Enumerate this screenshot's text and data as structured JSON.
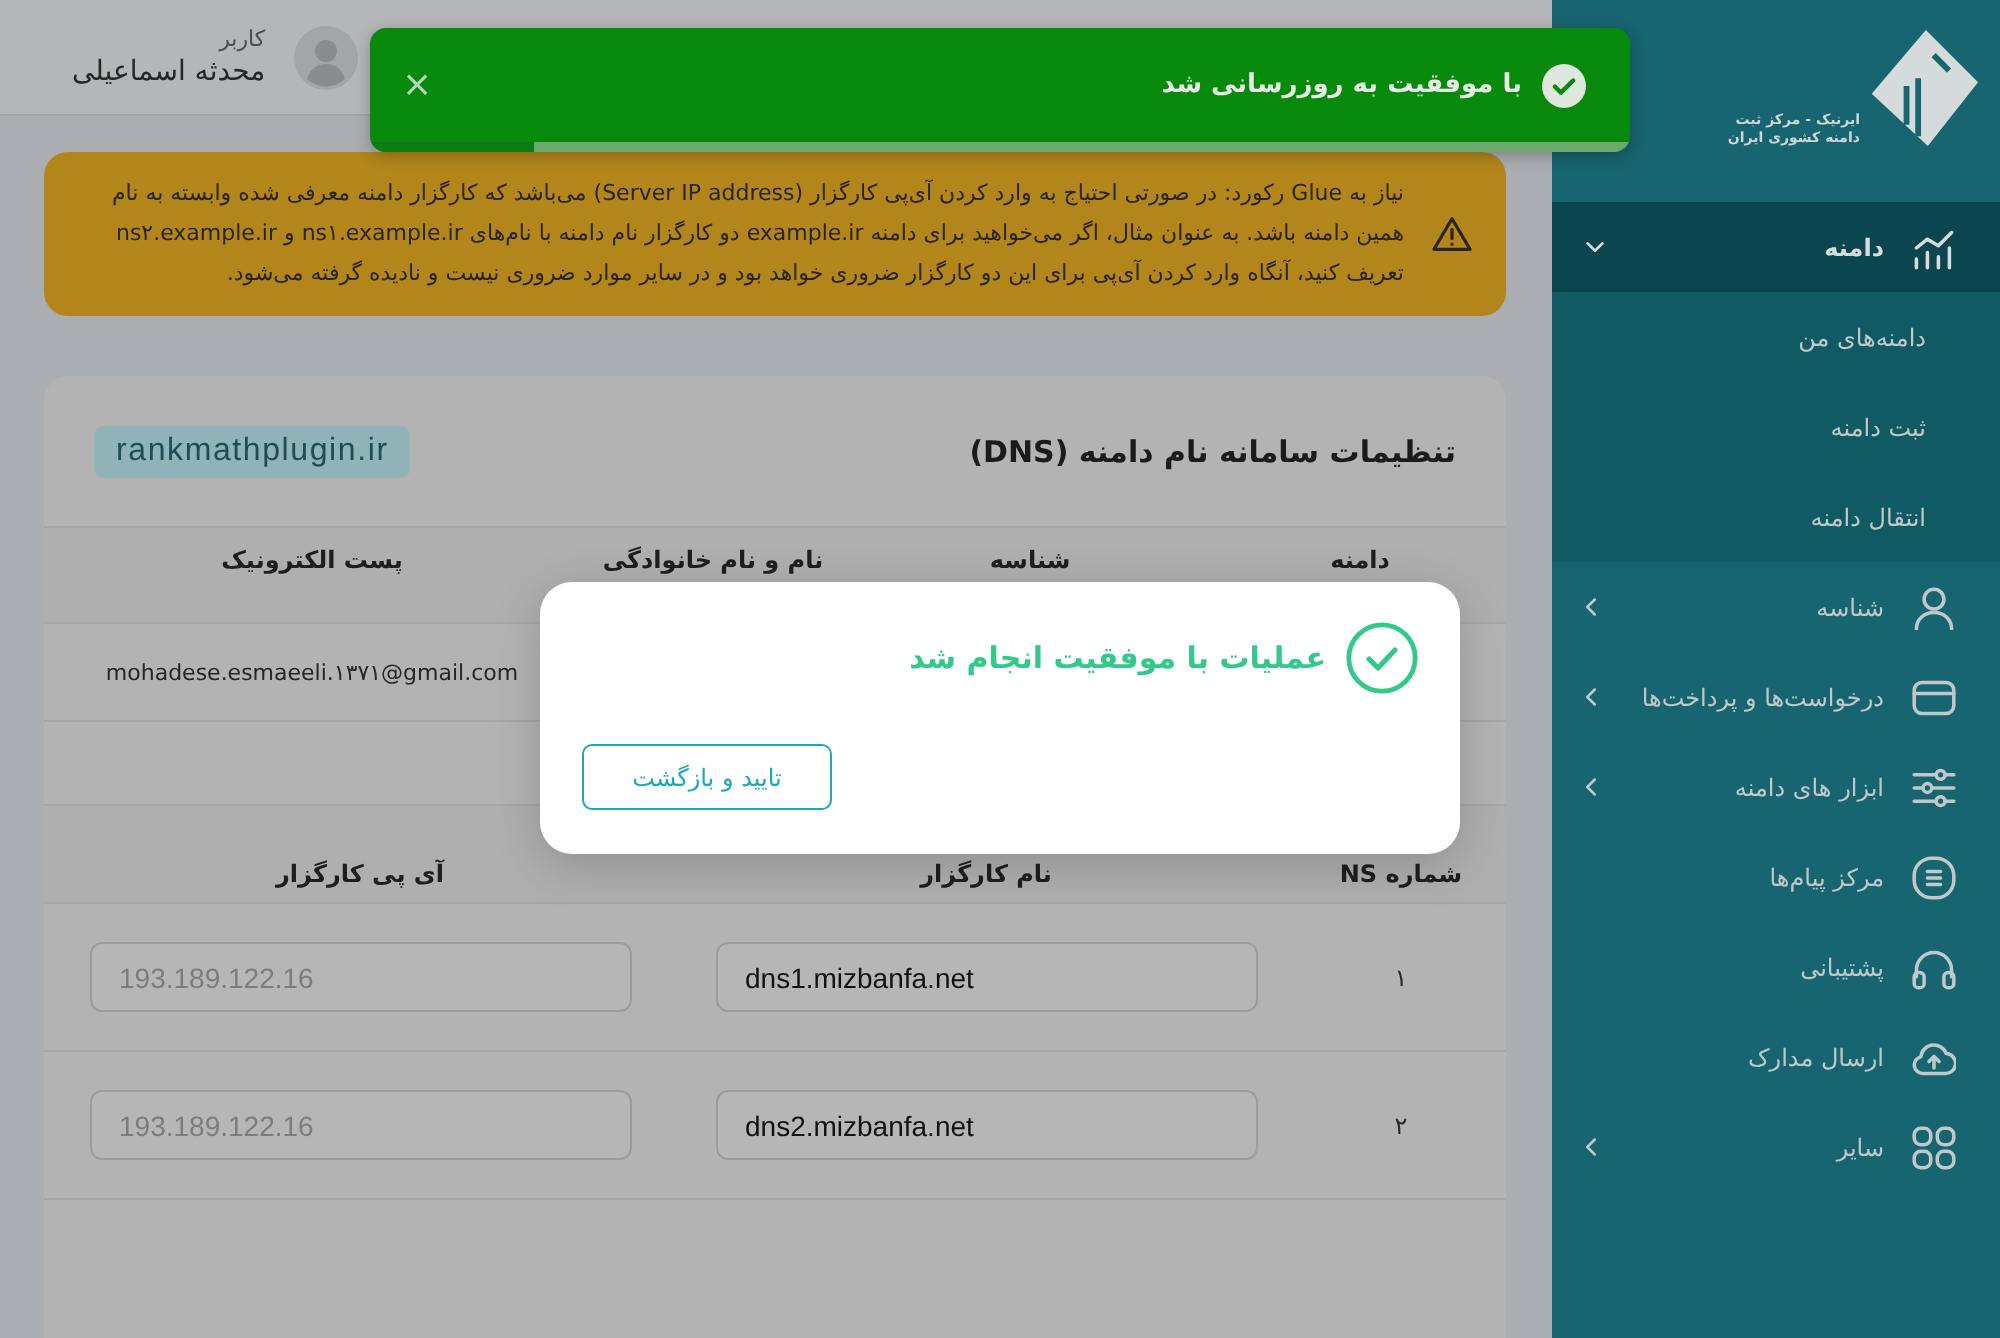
{
  "sidebar": {
    "logo": {
      "line_1": "ایرنیک - مرکز ثبت",
      "line_2": "دامنه کشوری ایران"
    },
    "items": [
      {
        "label": "دامنه",
        "selected": true,
        "expanded": true,
        "children": [
          {
            "label": "دامنه‌های من",
            "selected": false
          },
          {
            "label": "ثبت دامنه",
            "selected": false
          },
          {
            "label": "انتقال دامنه",
            "selected": false
          }
        ]
      },
      {
        "label": "شناسه",
        "selected": false,
        "expanded": false
      },
      {
        "label": "درخواست‌ها و پرداخت‌ها",
        "selected": false,
        "expanded": false
      },
      {
        "label": "ابزار های دامنه",
        "selected": false,
        "expanded": false
      },
      {
        "label": "مرکز پیام‌ها",
        "selected": false
      },
      {
        "label": "پشتیبانی",
        "selected": false
      },
      {
        "label": "ارسال مدارک",
        "selected": false
      },
      {
        "label": "سایر",
        "selected": false,
        "expanded": false
      }
    ]
  },
  "header": {
    "user_role": "کاربر",
    "user_name": "محدثه اسماعیلی"
  },
  "toast": {
    "message": "با موفقیت به روزرسانی شد",
    "close": "×",
    "level": 0.87
  },
  "notice": {
    "text": "نیاز به Glue رکورد: در صورتی احتیاج به وارد کردن آی‌پی کارگزار (Server IP address) می‌باشد که کارگزار دامنه معرفی شده وابسته به نام همین دامنه باشد. به عنوان مثال، اگر می‌خواهید برای دامنه example.ir دو کارگزار نام دامنه با نام‌های ns۱.example.ir و ns۲.example.ir تعریف کنید، آنگاه وارد کردن آی‌پی برای این دو کارگزار ضروری خواهد بود و در سایر موارد ضروری نیست و نادیده گرفته می‌شود."
  },
  "dns_card": {
    "title": "تنظیمات سامانه نام دامنه (DNS)",
    "domain": "rankmathplugin.ir",
    "contact_table": {
      "columns": [
        "دامنه",
        "شناسه",
        "نام و نام خانوادگی",
        "پست الکترونیک"
      ],
      "rows": [
        {
          "email": "mohadese.esmaeeli.۱۳۷۱@gmail.com"
        }
      ]
    },
    "ns_table": {
      "columns": [
        "شماره NS",
        "نام کارگزار",
        "آی پی کارگزار"
      ],
      "rows": [
        {
          "number": "۱",
          "server_name": {
            "value": "dns1.mizbanfa.net"
          },
          "server_ip": {
            "placeholder": "193.189.122.16"
          }
        },
        {
          "number": "۲",
          "server_name": {
            "value": "dns2.mizbanfa.net"
          },
          "server_ip": {
            "placeholder": "193.189.122.16"
          }
        }
      ]
    }
  },
  "modal": {
    "title": "عملیات با موفقیت انجام شد",
    "button": "تایید و بازگشت"
  }
}
